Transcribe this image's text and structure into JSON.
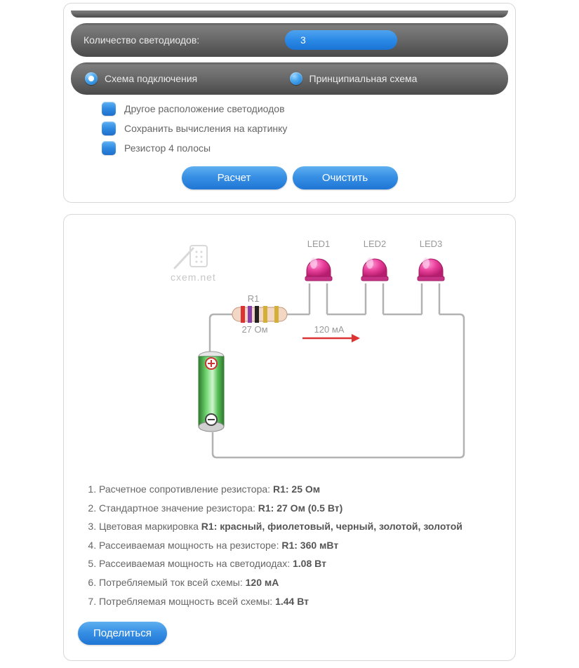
{
  "form": {
    "count_label": "Количество светодиодов:",
    "count_value": "3",
    "radio_connection": "Схема подключения",
    "radio_schematic": "Принципиальная схема",
    "checks": {
      "other_arrangement": "Другое расположение светодиодов",
      "save_image": "Сохранить вычисления на картинку",
      "resistor_4band": "Резистор 4 полосы"
    },
    "btn_calc": "Расчет",
    "btn_clear": "Очистить"
  },
  "diagram": {
    "watermark": "cxem.net",
    "r1_label": "R1",
    "r1_value": "27 Ом",
    "current_label": "120 мА",
    "led1": "LED1",
    "led2": "LED2",
    "led3": "LED3"
  },
  "results": {
    "r1_calc_label": "Расчетное сопротивление резистора: ",
    "r1_calc_value": "R1: 25 Ом",
    "r1_std_label": "Стандартное значение резистора: ",
    "r1_std_value": "R1: 27 Ом (0.5 Вт)",
    "r1_colors_label": "Цветовая маркировка ",
    "r1_colors_value": "R1: красный, фиолетовый, черный, золотой, золотой",
    "r1_pdiss_label": "Рассеиваемая мощность на резисторе: ",
    "r1_pdiss_value": "R1: 360 мВт",
    "led_pdiss_label": "Рассеиваемая мощность на светодиодах: ",
    "led_pdiss_value": "1.08 Вт",
    "total_i_label": "Потребляемый ток всей схемы: ",
    "total_i_value": "120 мА",
    "total_p_label": "Потребляемая мощность всей схемы: ",
    "total_p_value": "1.44 Вт"
  },
  "share_btn": "Поделиться"
}
